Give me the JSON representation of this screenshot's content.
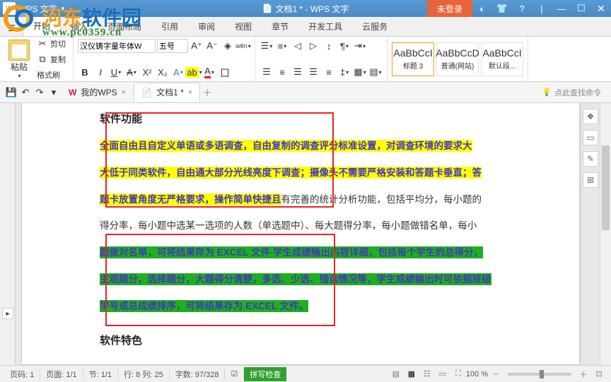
{
  "titlebar": {
    "app_name": "WPS 文字",
    "doc_title": "文档1 * - WPS 文字",
    "login": "未登录"
  },
  "watermark": {
    "site_name_1": "河东",
    "site_name_2": "软件园",
    "url": "www.pc0359.cn"
  },
  "menu": {
    "tabs": [
      "开始",
      "插入",
      "页面布局",
      "引用",
      "审阅",
      "视图",
      "章节",
      "开发工具",
      "云服务"
    ]
  },
  "ribbon": {
    "clipboard": {
      "cut": "剪切",
      "copy": "复制",
      "fmt": "格式刷",
      "paste": "粘贴"
    },
    "font": {
      "name": "汉仪铸字童年体W",
      "size": "五号"
    },
    "styles": [
      {
        "sample": "AaBbCcI",
        "name": "标题 3"
      },
      {
        "sample": "AaBbCcD",
        "name": "普通(网站)"
      },
      {
        "sample": "AaBbCcI",
        "name": "默认段..."
      }
    ]
  },
  "doctabs": {
    "wps_home": "我的WPS",
    "doc1": "文档1 *",
    "cmd_search": "点此查找命令"
  },
  "document": {
    "heading1": "软件功能",
    "line1a": "全面自由且自定义单语或多语调查，自由复制的",
    "line1b": "调查评分标准设置，对调查环境的要求大",
    "line2a": "大低于同类软件，自由通大部分光线亮度下调查；",
    "line2b": "摄像头不需要严格安装和答题卡垂直；答",
    "line3a": "题卡放置角度无严格要求，操作简单快捷且",
    "line3b": "有完善的统计分析功能，包括平均分，每小题的",
    "line4": "得分率，每小题中选某一选项的人数（单选题中）、每大题得分率，每小题做错名单，每小",
    "line5a": "题做对名单，可将结果存为 EXCEL 文件 学生成绩输出",
    "line5b": "内容详细，包括每个学生的总得分，",
    "line6a": "主观题分，选择题分，大题得分清楚，多选、少选、错选",
    "line6b": "情况等，学生成绩输出时可依据班级",
    "line7a": "学号或总成绩排序，可将结果存为 EXCEL 文件。",
    "heading2": "软件特色"
  },
  "status": {
    "page": "页码: 1",
    "pages": "页面: 1/1",
    "section": "节: 1/1",
    "pos": "行: 8  列: 25",
    "words": "字数: 97/328",
    "spell": "拼写检查",
    "zoom": "100 %"
  }
}
